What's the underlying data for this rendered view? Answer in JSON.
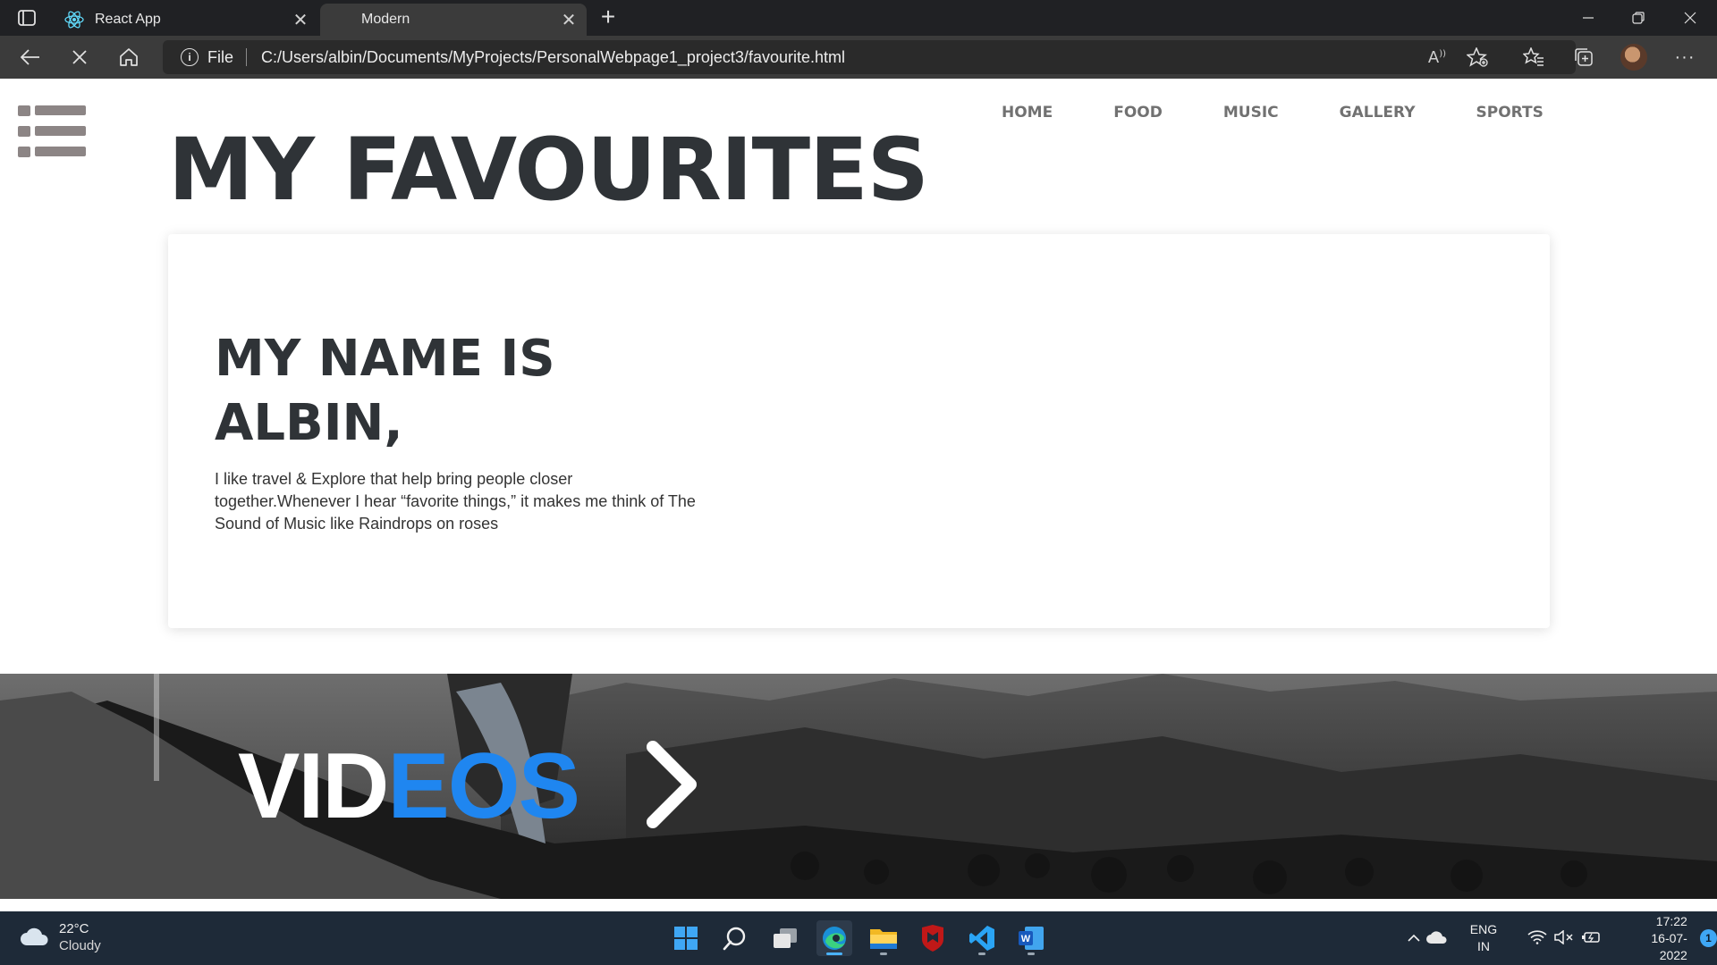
{
  "browser": {
    "tabs": [
      {
        "label": "React App",
        "active": false
      },
      {
        "label": "Modern",
        "active": true
      }
    ],
    "address": {
      "scheme_label": "File",
      "url": "C:/Users/albin/Documents/MyProjects/PersonalWebpage1_project3/favourite.html"
    },
    "icons": [
      "tab-actions-icon",
      "react-icon",
      "close-icon",
      "new-tab-icon",
      "minimize-icon",
      "restore-icon",
      "window-close-icon",
      "back-icon",
      "stop-loading-icon",
      "home-icon",
      "info-icon",
      "read-aloud-icon",
      "add-favorite-icon",
      "favorites-icon",
      "collections-icon",
      "profile-avatar",
      "more-icon"
    ]
  },
  "page": {
    "nav": [
      "HOME",
      "FOOD",
      "MUSIC",
      "GALLERY",
      "SPORTS"
    ],
    "title": "MY FAVOURITES",
    "card": {
      "heading": "MY NAME IS ALBIN,",
      "body": "I like travel & Explore that help bring people closer together.Whenever I hear “favorite things,” it makes me think of The Sound of Music like Raindrops on roses"
    },
    "hero": {
      "title_part1": "VID",
      "title_part2": "EOS",
      "arrow_icon": "chevron-right-icon"
    }
  },
  "taskbar": {
    "weather": {
      "temp": "22°C",
      "condition": "Cloudy"
    },
    "apps": [
      "windows-start-icon",
      "search-icon",
      "task-view-icon",
      "edge-icon",
      "file-explorer-icon",
      "mcafee-icon",
      "vscode-icon",
      "word-icon"
    ],
    "tray": {
      "language": "ENG",
      "region": "IN",
      "time": "17:22",
      "date": "16-07-2022",
      "notification_count": "1"
    }
  },
  "colors": {
    "title": "#2f3337",
    "nav": "#717171",
    "accent_blue": "#1f86f0",
    "taskbar": "#1e2a38"
  }
}
